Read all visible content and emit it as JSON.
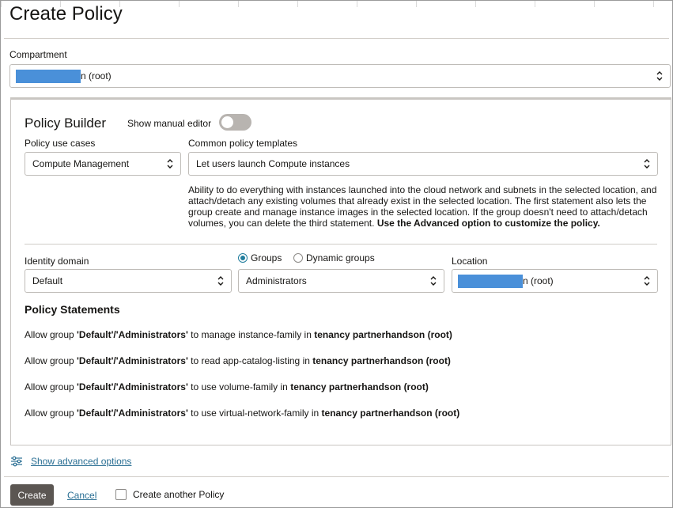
{
  "page": {
    "title": "Create Policy"
  },
  "compartment": {
    "label": "Compartment",
    "value_suffix": "n (root)"
  },
  "builder": {
    "title": "Policy Builder",
    "manual_editor_label": "Show manual editor",
    "manual_editor_on": false,
    "use_cases_label": "Policy use cases",
    "use_case_value": "Compute Management",
    "templates_label": "Common policy templates",
    "template_value": "Let users launch Compute instances",
    "description_text": "Ability to do everything with instances launched into the cloud network and subnets in the selected location, and attach/detach any existing volumes that already exist in the selected location. The first statement also lets the group create and manage instance images in the selected location. If the group doesn't need to attach/detach volumes, you can delete the third statement. ",
    "description_bold": "Use the Advanced option to customize the policy.",
    "identity_domain_label": "Identity domain",
    "identity_domain_value": "Default",
    "radio_groups_label": "Groups",
    "radio_dynamic_label": "Dynamic groups",
    "group_value": "Administrators",
    "location_label": "Location",
    "location_value_suffix": "n (root)"
  },
  "statements": {
    "title": "Policy Statements",
    "items": [
      {
        "prefix": "Allow group ",
        "group": "'Default'/'Administrators'",
        "middle": " to manage instance-family in ",
        "target": "tenancy partnerhandson (root)"
      },
      {
        "prefix": "Allow group ",
        "group": "'Default'/'Administrators'",
        "middle": " to read app-catalog-listing in ",
        "target": "tenancy partnerhandson (root)"
      },
      {
        "prefix": "Allow group ",
        "group": "'Default'/'Administrators'",
        "middle": " to use volume-family in ",
        "target": "tenancy partnerhandson (root)"
      },
      {
        "prefix": "Allow group ",
        "group": "'Default'/'Administrators'",
        "middle": " to use virtual-network-family in ",
        "target": "tenancy partnerhandson (root)"
      }
    ]
  },
  "advanced": {
    "link_label": "Show advanced options"
  },
  "footer": {
    "create_label": "Create",
    "cancel_label": "Cancel",
    "another_label": "Create another Policy"
  },
  "colors": {
    "accent": "#227e9e",
    "link": "#2a6f94",
    "primary_button": "#5b5652",
    "redaction": "#4a90d9"
  },
  "icons": [
    "chevron-updown-icon",
    "sliders-icon"
  ]
}
